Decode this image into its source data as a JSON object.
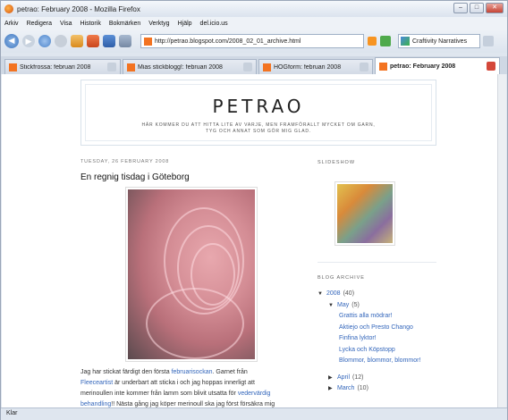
{
  "window": {
    "title": "petrao: February 2008 - Mozilla Firefox"
  },
  "menu": [
    "Arkiv",
    "Redigera",
    "Visa",
    "Historik",
    "Bokmärken",
    "Verktyg",
    "Hjälp",
    "del.icio.us"
  ],
  "toolbar": {
    "url": "http://petrao.blogspot.com/2008_02_01_archive.html",
    "search_engine": "Craftivity Narratives"
  },
  "tabs": [
    {
      "label": "Stickfrossa: februari 2008",
      "active": false
    },
    {
      "label": "Mias stickblogg!: februari 2008",
      "active": false
    },
    {
      "label": "HÖGform: februari 2008",
      "active": false
    },
    {
      "label": "petrao: February 2008",
      "active": true
    }
  ],
  "blog": {
    "title": "PETRAO",
    "description_line1": "HÄR KOMMER DU ATT HITTA LITE AV VARJE, MEN FRAMFÖRALLT MYCKET OM GARN,",
    "description_line2": "TYG OCH ANNAT SOM GÖR MIG GLAD."
  },
  "post": {
    "date": "TUESDAY, 26 FEBRUARY 2008",
    "title": "En regnig tisdag i Göteborg",
    "body_1a": "Jag har stickat färdigt den första ",
    "body_1link": "februarisockan",
    "body_1b": ". Garnet från",
    "body_2link": "Fleeceartist",
    "body_2b": " är underbart att sticka i och jag hoppas innerligt att",
    "body_3a": "merinoullen inte kommer från lamm som blivit utsatta för ",
    "body_3link": "vedervärdig",
    "body_4link": "behandling",
    "body_4b": "!! Nästa gång jag köper merinoull ska jag först försäkra mig"
  },
  "sidebar": {
    "slideshow_label": "SLIDESHOW",
    "archive_label": "BLOG ARCHIVE",
    "archive": {
      "year": "2008",
      "year_count": "(40)",
      "month": "May",
      "month_count": "(5)",
      "posts": [
        "Grattis alla mödrar!",
        "Aktiejo och Presto Chango",
        "Finfina lyktor!",
        "Lycka och Köpstopp",
        "Blommor, blommor, blommor!"
      ],
      "other_months": [
        {
          "name": "April",
          "count": "(12)"
        },
        {
          "name": "March",
          "count": "(10)"
        }
      ]
    }
  },
  "status": {
    "text": "Klar"
  }
}
